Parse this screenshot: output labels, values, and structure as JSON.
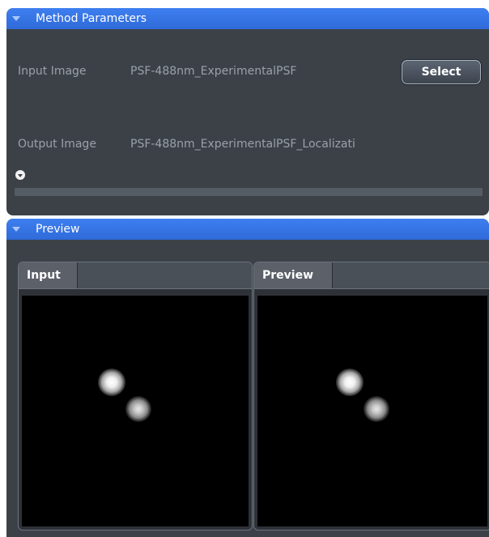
{
  "method_parameters": {
    "header_title": "Method Parameters",
    "input_label": "Input Image",
    "input_value": "PSF-488nm_ExperimentalPSF",
    "select_label": "Select",
    "output_label": "Output Image",
    "output_value": "PSF-488nm_ExperimentalPSF_Localizati"
  },
  "preview": {
    "header_title": "Preview",
    "tabs": {
      "input": "Input",
      "preview": "Preview"
    }
  }
}
